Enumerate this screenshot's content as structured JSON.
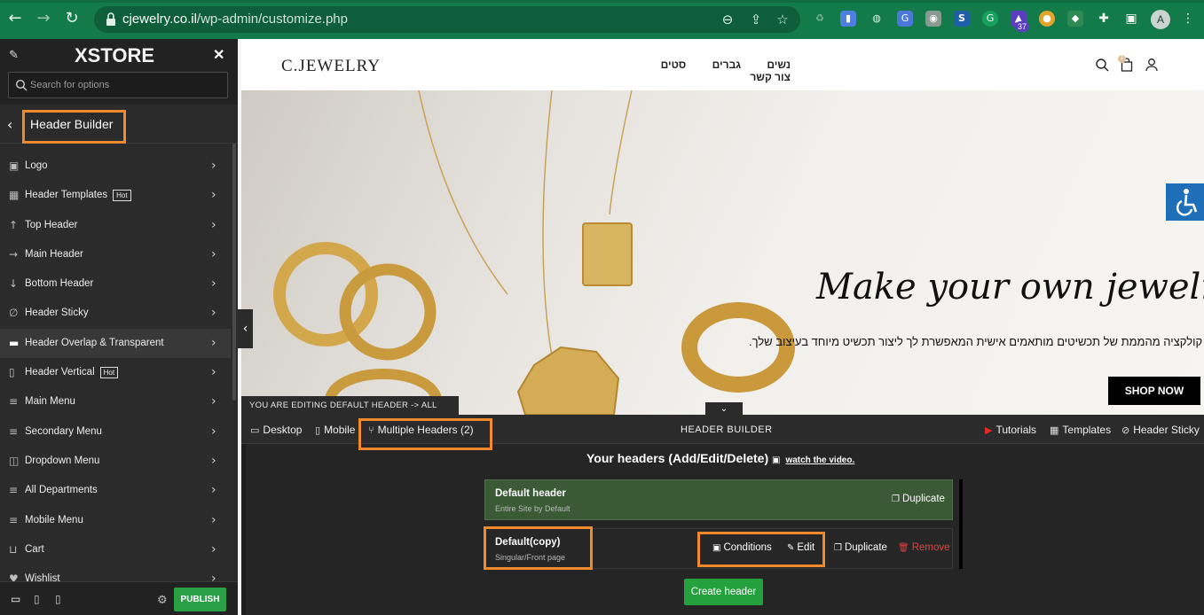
{
  "browser": {
    "url_host": "cjewelry.co.il",
    "url_path": "/wp-admin/customize.php",
    "profile_initial": "A",
    "ext_badge": "37"
  },
  "panel": {
    "brand": "XSTORE",
    "search_placeholder": "Search for options",
    "section_title": "Header Builder",
    "items": [
      {
        "label": "Logo",
        "icon": "image-icon",
        "hot": ""
      },
      {
        "label": "Header Templates",
        "icon": "templates-icon",
        "hot": "Hot"
      },
      {
        "label": "Top Header",
        "icon": "arrow-up-icon",
        "hot": ""
      },
      {
        "label": "Main Header",
        "icon": "arrow-right-icon",
        "hot": ""
      },
      {
        "label": "Bottom Header",
        "icon": "arrow-down-icon",
        "hot": ""
      },
      {
        "label": "Header Sticky",
        "icon": "link-icon",
        "hot": ""
      },
      {
        "label": "Header Overlap & Transparent",
        "icon": "overlay-icon",
        "hot": ""
      },
      {
        "label": "Header Vertical",
        "icon": "vertical-icon",
        "hot": "Hot"
      },
      {
        "label": "Main Menu",
        "icon": "menu-icon",
        "hot": ""
      },
      {
        "label": "Secondary Menu",
        "icon": "menu-icon",
        "hot": ""
      },
      {
        "label": "Dropdown Menu",
        "icon": "dropdown-icon",
        "hot": ""
      },
      {
        "label": "All Departments",
        "icon": "menu-icon",
        "hot": ""
      },
      {
        "label": "Mobile Menu",
        "icon": "menu-icon",
        "hot": ""
      },
      {
        "label": "Cart",
        "icon": "cart-icon",
        "hot": ""
      },
      {
        "label": "Wishlist",
        "icon": "heart-icon",
        "hot": ""
      }
    ],
    "publish_label": "PUBLISH"
  },
  "site": {
    "logo": "C.JEWELRY",
    "nav": [
      "נשים",
      "גברים",
      "סטים",
      "צור קשר"
    ],
    "cart_count": "1",
    "headline": "Make your own jewelry",
    "subline": "קולקציה מהממת של תכשיטים מותאמים אישית המאפשרת לך ליצור תכשיט מיוחד בעיצוב שלך.",
    "shop_label": "SHOP NOW"
  },
  "builder": {
    "editing_label": "YOU ARE EDITING DEFAULT HEADER -> ALL SITE",
    "tab_desktop": "Desktop",
    "tab_mobile": "Mobile",
    "tab_multiple": "Multiple Headers (2)",
    "title": "HEADER BUILDER",
    "tutorials": "Tutorials",
    "templates": "Templates",
    "header_sticky": "Header Sticky",
    "your_headers": "Your headers (Add/Edit/Delete)",
    "watch": "watch the video.",
    "headers": [
      {
        "name": "Default header",
        "desc": "Entire Site by Default",
        "duplicate": "Duplicate"
      },
      {
        "name": "Default(copy)",
        "desc": "Singular/Front page",
        "conditions": "Conditions",
        "edit": "Edit",
        "duplicate": "Duplicate",
        "remove": "Remove"
      }
    ],
    "create_label": "Create header"
  },
  "colors": {
    "accent_highlight": "#f08a2c",
    "publish_green": "#2aa046",
    "default_row": "#3a5a36",
    "remove_red": "#e04040"
  }
}
